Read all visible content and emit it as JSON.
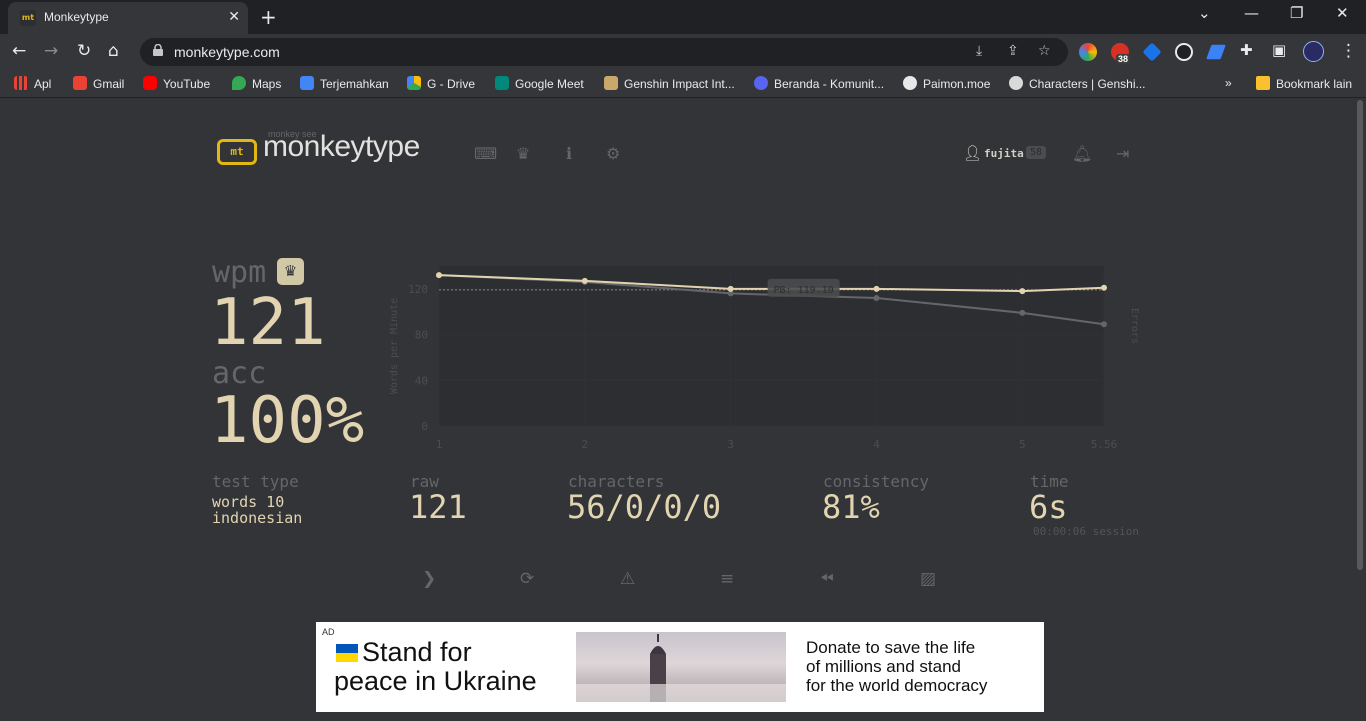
{
  "browser": {
    "tab_title": "Monkeytype",
    "favicon_text": "mt",
    "url": "monkeytype.com",
    "extension_badge": "38",
    "bookmarks": [
      {
        "label": "Apl",
        "color": "#ea4335"
      },
      {
        "label": "Gmail",
        "color": "#ea4335"
      },
      {
        "label": "YouTube",
        "color": "#ff0000"
      },
      {
        "label": "Maps",
        "color": "#34a853"
      },
      {
        "label": "Terjemahkan",
        "color": "#4285f4"
      },
      {
        "label": "G - Drive",
        "color": "#fbbc04"
      },
      {
        "label": "Google Meet",
        "color": "#00897b"
      },
      {
        "label": "Genshin Impact Int...",
        "color": "#c8a86b"
      },
      {
        "label": "Beranda - Komunit...",
        "color": "#5865f2"
      },
      {
        "label": "Paimon.moe",
        "color": "#e8e8e8"
      },
      {
        "label": "Characters | Genshi...",
        "color": "#d9d9d9"
      }
    ],
    "other_bookmarks": "Bookmark lain"
  },
  "header": {
    "logo_icon_text": "mt",
    "logo_sub": "monkey see",
    "logo_text": "monkeytype",
    "username": "fujita",
    "level": "58"
  },
  "result": {
    "wpm_label": "wpm",
    "wpm": "121",
    "acc_label": "acc",
    "acc": "100%",
    "test_type_label": "test type",
    "test_type_line1": "words 10",
    "test_type_line2": "indonesian",
    "raw_label": "raw",
    "raw": "121",
    "characters_label": "characters",
    "characters": "56/0/0/0",
    "consistency_label": "consistency",
    "consistency": "81%",
    "time_label": "time",
    "time": "6s",
    "session": "00:00:06 session"
  },
  "chart_data": {
    "type": "line",
    "x": [
      1,
      2,
      3,
      4,
      5,
      5.56
    ],
    "x_tick_labels": [
      "1",
      "2",
      "3",
      "4",
      "5",
      "5.56"
    ],
    "ylim": [
      0,
      140
    ],
    "y_ticks": [
      0,
      40,
      80,
      120
    ],
    "ylabel": "Words per Minute",
    "ylabel_right": "Errors",
    "series": [
      {
        "role": "wpm",
        "values": [
          132,
          127,
          120,
          120,
          118,
          121
        ],
        "color": "#e2d4b0"
      },
      {
        "role": "raw",
        "values": [
          132,
          126,
          116,
          112,
          99,
          89
        ],
        "color": "#646669"
      }
    ],
    "pb_value": 119.1,
    "pb_label": "PB: 119.10",
    "grid": true
  },
  "ad": {
    "tag": "AD",
    "headline1": "Stand for",
    "headline2": "peace in Ukraine",
    "body1": "Donate to save the life",
    "body2": "of millions and stand",
    "body3": "for the world democracy"
  }
}
